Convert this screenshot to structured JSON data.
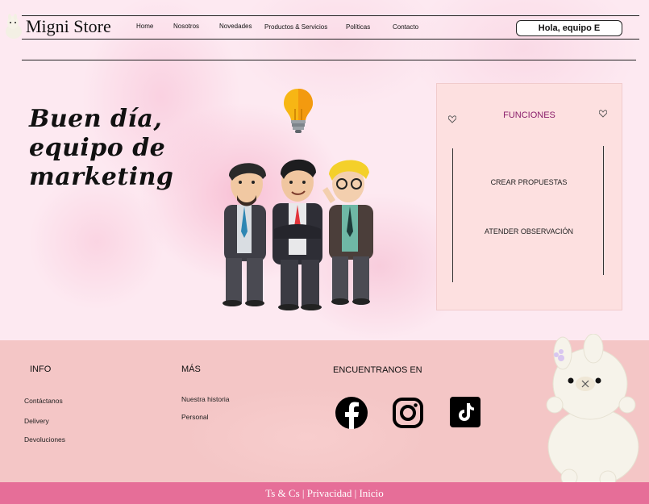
{
  "header": {
    "brand": "Migni Store",
    "nav": [
      "Home",
      "Nosotros",
      "Novedades",
      "Productos & Servicios",
      "Políticas",
      "Contacto"
    ],
    "greeting_button": "Hola, equipo E"
  },
  "hero": {
    "title_line1": "Buen día,",
    "title_line2": "equipo de",
    "title_line3": "marketing"
  },
  "panel": {
    "title": "FUNCIONES",
    "links": [
      "CREAR PROPUESTAS",
      "ATENDER OBSERVACIÓN"
    ]
  },
  "footer": {
    "info_title": "INFO",
    "info_links": [
      "Contáctanos",
      "Delivery",
      "Devoluciones"
    ],
    "more_title": "MÁS",
    "more_links": [
      "Nuestra historia",
      "Personal"
    ],
    "social_title": "ENCUENTRANOS EN",
    "social_icons": [
      "facebook-icon",
      "instagram-icon",
      "tiktok-icon"
    ]
  },
  "bottom_bar": {
    "links": [
      "Ts & Cs",
      "Privacidad",
      "Inicio"
    ],
    "separator": "|"
  },
  "colors": {
    "footer_bar": "#e66e98",
    "panel_bg": "#fde0e0",
    "panel_title": "#8a1e6a",
    "footer_bg": "#f4c6c6"
  }
}
